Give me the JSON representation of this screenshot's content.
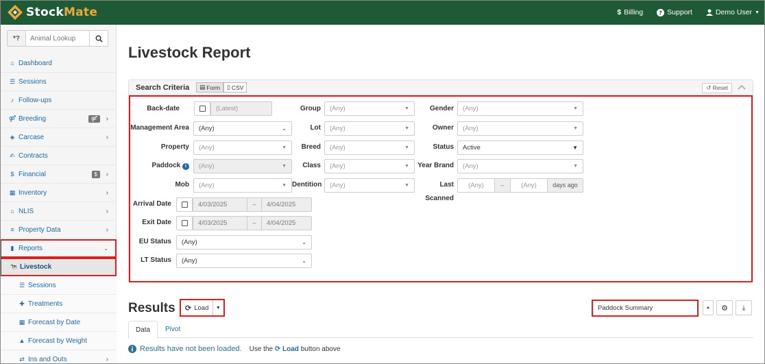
{
  "app": {
    "logo_a": "Stock",
    "logo_b": "Mate",
    "topnav": {
      "billing": "Billing",
      "support": "Support",
      "user": "Demo User"
    }
  },
  "sidebar": {
    "lookup_prefix": "*?",
    "lookup_placeholder": "Animal Lookup",
    "items": [
      {
        "label": "Dashboard"
      },
      {
        "label": "Sessions"
      },
      {
        "label": "Follow-ups"
      },
      {
        "label": "Breeding"
      },
      {
        "label": "Carcase"
      },
      {
        "label": "Contracts"
      },
      {
        "label": "Financial",
        "badge": "$"
      },
      {
        "label": "Inventory"
      },
      {
        "label": "NLIS"
      },
      {
        "label": "Property Data"
      },
      {
        "label": "Reports"
      }
    ],
    "reports_sub": [
      {
        "label": "Livestock"
      },
      {
        "label": "Sessions"
      },
      {
        "label": "Treatments"
      },
      {
        "label": "Forecast by Date"
      },
      {
        "label": "Forecast by Weight"
      },
      {
        "label": "Ins and Outs"
      }
    ]
  },
  "main": {
    "title": "Livestock Report",
    "search": {
      "title": "Search Criteria",
      "toggle_form": "Form",
      "toggle_csv": "CSV",
      "reset": "Reset"
    },
    "fields": {
      "back_date": {
        "label": "Back-date",
        "value": "(Latest)"
      },
      "management_area": {
        "label": "Management Area",
        "value": "(Any)"
      },
      "property": {
        "label": "Property",
        "value": "(Any)"
      },
      "paddock": {
        "label": "Paddock",
        "value": "(Any)"
      },
      "mob": {
        "label": "Mob",
        "value": "(Any)"
      },
      "arrival_date": {
        "label": "Arrival Date",
        "from": "4/03/2025",
        "to": "4/04/2025"
      },
      "exit_date": {
        "label": "Exit Date",
        "from": "4/03/2025",
        "to": "4/04/2025"
      },
      "eu_status": {
        "label": "EU Status",
        "value": "(Any)"
      },
      "lt_status": {
        "label": "LT Status",
        "value": "(Any)"
      },
      "group": {
        "label": "Group",
        "value": "(Any)"
      },
      "lot": {
        "label": "Lot",
        "value": "(Any)"
      },
      "breed": {
        "label": "Breed",
        "value": "(Any)"
      },
      "class": {
        "label": "Class",
        "value": "(Any)"
      },
      "dentition": {
        "label": "Dentition",
        "value": "(Any)"
      },
      "gender": {
        "label": "Gender",
        "value": "(Any)"
      },
      "owner": {
        "label": "Owner",
        "value": "(Any)"
      },
      "status": {
        "label": "Status",
        "value": "Active"
      },
      "year_brand": {
        "label": "Year Brand",
        "value": "(Any)"
      },
      "last_scanned": {
        "label": "Last Scanned",
        "from": "(Any)",
        "to": "(Any)",
        "unit": "days ago"
      },
      "range_sep": "–"
    },
    "results": {
      "title": "Results",
      "load": "Load",
      "summary": "Paddock Summary",
      "tabs": [
        "Data",
        "Pivot"
      ],
      "notice": "Results have not been loaded.",
      "hint_a": "Use the",
      "hint_b": "Load",
      "hint_c": "button above"
    }
  },
  "colors": {
    "header": "#1e5a36",
    "accent": "#f0a73a",
    "link": "#1f6aa5",
    "highlight": "#d9201e"
  }
}
